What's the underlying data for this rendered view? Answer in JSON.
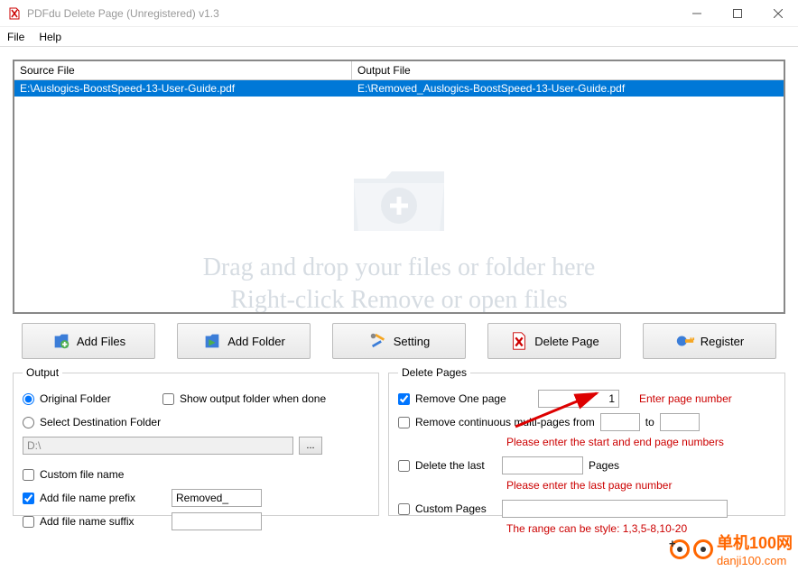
{
  "window": {
    "title": "PDFdu Delete Page (Unregistered) v1.3"
  },
  "menu": {
    "file": "File",
    "help": "Help"
  },
  "table": {
    "col_source": "Source File",
    "col_output": "Output File",
    "row_source": "E:\\Auslogics-BoostSpeed-13-User-Guide.pdf",
    "row_output": "E:\\Removed_Auslogics-BoostSpeed-13-User-Guide.pdf"
  },
  "watermark": {
    "line1": "Drag and drop your files or folder here",
    "line2": "Right-click Remove or open files"
  },
  "buttons": {
    "add_files": "Add Files",
    "add_folder": "Add Folder",
    "setting": "Setting",
    "delete_page": "Delete Page",
    "register": "Register"
  },
  "output": {
    "legend": "Output",
    "original_folder": "Original Folder",
    "show_when_done": "Show output folder when done",
    "select_dest": "Select Destination Folder",
    "dest_path": "D:\\",
    "browse": "...",
    "custom_name": "Custom file name",
    "prefix_label": "Add file name prefix",
    "prefix_value": "Removed_",
    "suffix_label": "Add file name suffix"
  },
  "delete": {
    "legend": "Delete Pages",
    "remove_one": "Remove One page",
    "one_value": "1",
    "hint_one": "Enter page number",
    "remove_multi": "Remove continuous multi-pages  from",
    "to": "to",
    "hint_multi": "Please enter the start and end page numbers",
    "delete_last": "Delete the last",
    "pages_word": "Pages",
    "hint_last": "Please enter the last page number",
    "custom_pages": "Custom Pages",
    "hint_custom": "The range can be style:  1,3,5-8,10-20"
  },
  "brand": {
    "cn": "单机100网",
    "url": "danji100.com"
  }
}
